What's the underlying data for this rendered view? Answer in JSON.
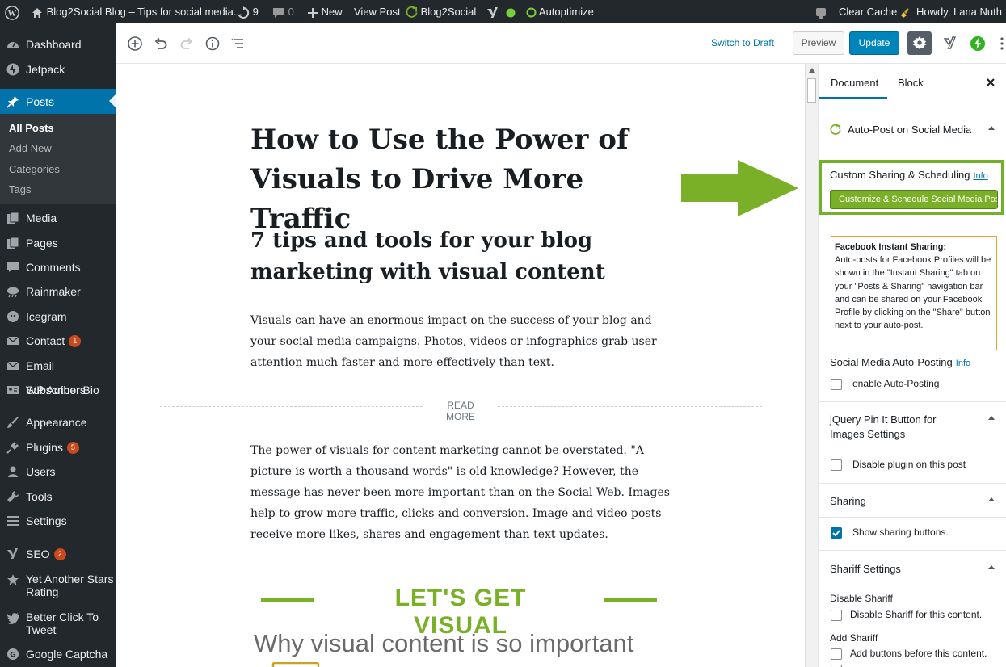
{
  "adminbar": {
    "site_title": "Blog2Social Blog – Tips for social media...",
    "updates_count": "9",
    "comments_count": "0",
    "new_label": "New",
    "view_post_label": "View Post",
    "b2s_label": "Blog2Social",
    "autoptimize_label": "Autoptimize",
    "clear_cache_label": "Clear Cache",
    "howdy_label": "Howdy, Lana Nuth"
  },
  "menu": {
    "dashboard": "Dashboard",
    "jetpack": "Jetpack",
    "posts": "Posts",
    "posts_sub": [
      "All Posts",
      "Add New",
      "Categories",
      "Tags"
    ],
    "media": "Media",
    "pages": "Pages",
    "comments": "Comments",
    "rainmaker": "Rainmaker",
    "icegram": "Icegram",
    "contact": "Contact",
    "contact_badge": "1",
    "email_subscribers": "Email Subscribers",
    "wp_author_bio": "WP Author Bio",
    "appearance": "Appearance",
    "plugins": "Plugins",
    "plugins_badge": "5",
    "users": "Users",
    "tools": "Tools",
    "settings": "Settings",
    "seo": "SEO",
    "seo_badge": "2",
    "yasr_line1": "Yet Another Stars",
    "yasr_line2": "Rating",
    "bctt_line1": "Better Click To",
    "bctt_line2": "Tweet",
    "google_captcha": "Google Captcha"
  },
  "toolbar": {
    "switch_to_draft": "Switch to Draft",
    "preview": "Preview",
    "update": "Update"
  },
  "editor": {
    "title": "How to Use the Power of Visuals to Drive More Traffic",
    "subtitle": "7 tips and tools for your blog marketing with visual content",
    "para1": "Visuals can have an enormous impact on the success of your blog and your social media campaigns.  Photos, videos or infographics grab user attention much faster and more effectively than text.",
    "read_more": "READ MORE",
    "para2": "The power of visuals for content marketing cannot be overstated. \"A picture is worth a thousand words\" is old knowledge? However, the message has never been more important than on the Social Web. Images help to grow more traffic, clicks and conversion. Image and video posts receive more likes, shares and engagement than text updates.",
    "visual_heading": "LET'S GET VISUAL",
    "why_heading": "Why visual content is so important"
  },
  "sidebar": {
    "tab_document": "Document",
    "tab_block": "Block",
    "autopost_title": "Auto-Post on Social Media",
    "custom_sharing_label": "Custom Sharing & Scheduling",
    "info": "Info",
    "customize_button": "Customize & Schedule Social Media Posts",
    "fb_notice_title": "Facebook Instant Sharing:",
    "fb_notice_body": "Auto-posts for Facebook Profiles will be shown in the \"Instant Sharing\" tab on your \"Posts & Sharing\" navigation bar and can be shared on your Facebook Profile by clicking on the \"Share\" button next to your auto-post.",
    "social_autopost_label": "Social Media Auto-Posting",
    "enable_autopost": "enable Auto-Posting",
    "pinit_title": "jQuery Pin It Button for Images Settings",
    "disable_plugin": "Disable plugin on this post",
    "sharing_title": "Sharing",
    "show_sharing": "Show sharing buttons.",
    "shariff_title": "Shariff Settings",
    "disable_shariff_heading": "Disable Shariff",
    "disable_shariff_label": "Disable Shariff for this content.",
    "add_shariff_heading": "Add Shariff",
    "add_shariff_label": "Add buttons before this content."
  },
  "colors": {
    "admin_dark": "#23282d",
    "wp_blue": "#0073aa",
    "b2s_green": "#7ab027",
    "badge_orange": "#ca4a1f"
  }
}
